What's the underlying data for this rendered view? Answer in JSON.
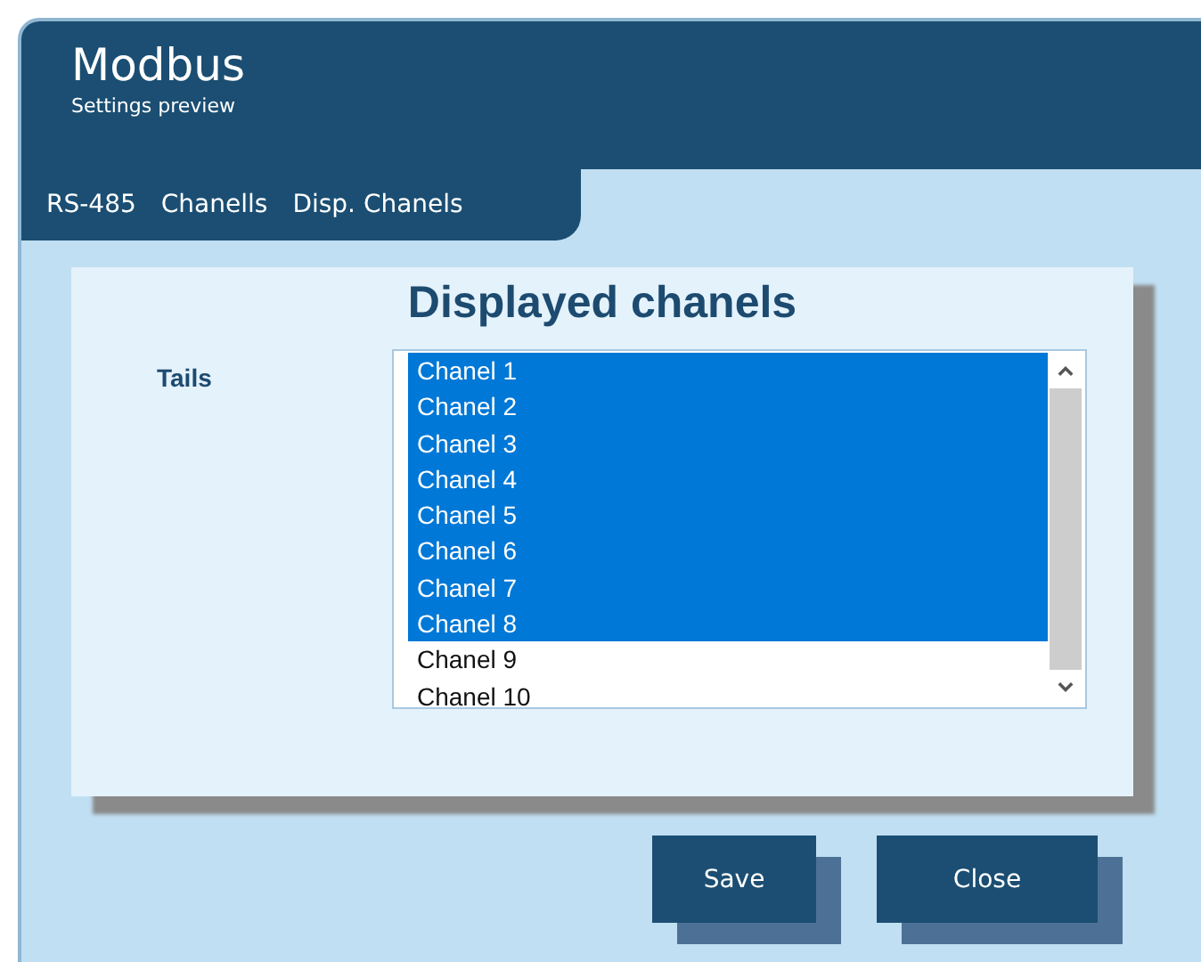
{
  "header": {
    "title": "Modbus",
    "subtitle": "Settings preview"
  },
  "tabs": [
    {
      "label": "RS-485"
    },
    {
      "label": "Chanells"
    },
    {
      "label": "Disp. Chanels"
    }
  ],
  "panel": {
    "title": "Displayed chanels",
    "field_label": "Tails",
    "items": [
      {
        "label": "Chanel 1",
        "selected": true
      },
      {
        "label": "Chanel 2",
        "selected": true
      },
      {
        "label": "Chanel 3",
        "selected": true
      },
      {
        "label": "Chanel 4",
        "selected": true
      },
      {
        "label": "Chanel 5",
        "selected": true
      },
      {
        "label": "Chanel 6",
        "selected": true
      },
      {
        "label": "Chanel 7",
        "selected": true
      },
      {
        "label": "Chanel 8",
        "selected": true
      },
      {
        "label": "Chanel 9",
        "selected": false
      },
      {
        "label": "Chanel 10",
        "selected": false
      }
    ]
  },
  "buttons": [
    "Save",
    "Close"
  ]
}
